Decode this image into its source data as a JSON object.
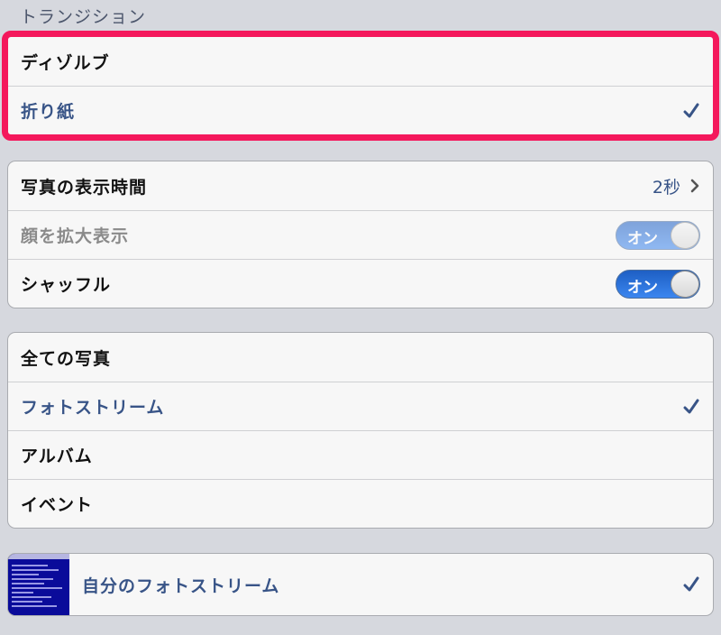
{
  "transition": {
    "header": "トランジション",
    "options": [
      {
        "label": "ディゾルブ",
        "selected": false
      },
      {
        "label": "折り紙",
        "selected": true
      }
    ]
  },
  "display": {
    "duration_label": "写真の表示時間",
    "duration_value": "2秒",
    "zoom_faces_label": "顔を拡大表示",
    "zoom_faces_toggle": "オン",
    "shuffle_label": "シャッフル",
    "shuffle_toggle": "オン"
  },
  "sources": [
    {
      "label": "全ての写真",
      "selected": false
    },
    {
      "label": "フォトストリーム",
      "selected": true
    },
    {
      "label": "アルバム",
      "selected": false
    },
    {
      "label": "イベント",
      "selected": false
    }
  ],
  "my_stream": {
    "label": "自分のフォトストリーム",
    "selected": true
  },
  "colors": {
    "highlight_border": "#f4185c",
    "selected_text": "#385487",
    "toggle_blue": "#2f78e3"
  }
}
